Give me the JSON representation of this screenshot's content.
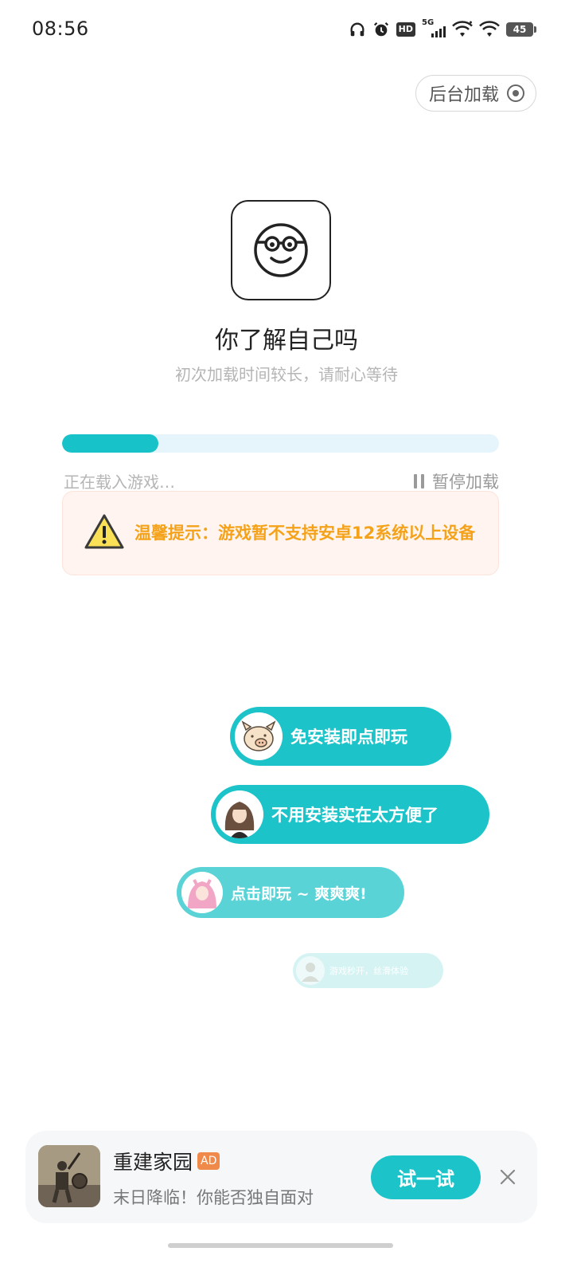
{
  "status_bar": {
    "time": "08:56",
    "network_label": "5G",
    "battery": "45",
    "hd_label": "HD",
    "icons": [
      "headphones-icon",
      "alarm-icon",
      "hd-icon",
      "5g-signal-icon",
      "wifi-icon",
      "wifi-icon",
      "battery-icon"
    ]
  },
  "header": {
    "background_load_label": "后台加载"
  },
  "game": {
    "title": "你了解自己吗",
    "subtitle": "初次加载时间较长，请耐心等待"
  },
  "loading": {
    "progress": 0.22,
    "status_text": "正在载入游戏…",
    "pause_label": "暂停加载"
  },
  "warning": {
    "text": "温馨提示：游戏暂不支持安卓12系统以上设备"
  },
  "bubbles": [
    {
      "text": "免安装即点即玩"
    },
    {
      "text": "不用安装实在太方便了"
    },
    {
      "text": "点击即玩 ~ 爽爽爽!"
    },
    {
      "text": "游戏秒开，丝滑体验"
    }
  ],
  "ad": {
    "title": "重建家园",
    "badge": "AD",
    "description": "末日降临！你能否独自面对",
    "button_label": "试一试"
  },
  "colors": {
    "accent": "#1cc4c9",
    "warning_text": "#f5a21b",
    "warning_bg": "#fff4ef",
    "ad_badge": "#f08a4b"
  }
}
